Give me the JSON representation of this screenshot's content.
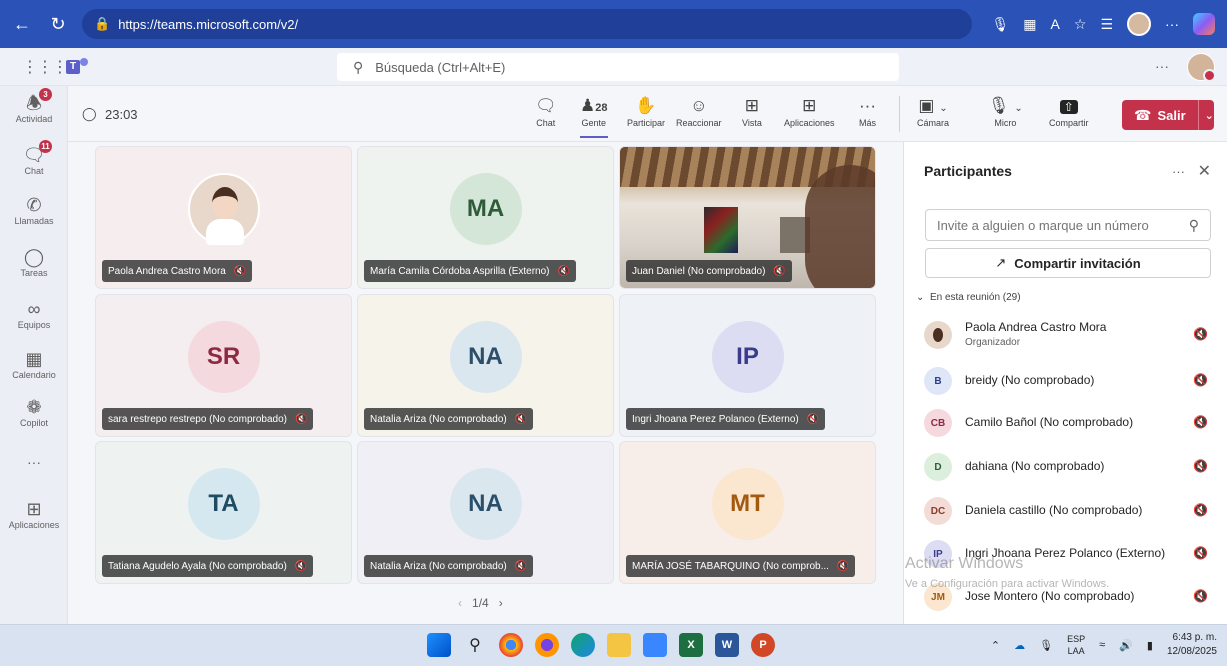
{
  "browser": {
    "url": "https://teams.microsoft.com/v2/"
  },
  "topbar": {
    "search_placeholder": "Búsqueda (Ctrl+Alt+E)",
    "more": "···"
  },
  "rail": [
    {
      "label": "Actividad",
      "icon": "bell-icon",
      "badge": "3"
    },
    {
      "label": "Chat",
      "icon": "chat-icon",
      "badge": "11"
    },
    {
      "label": "Llamadas",
      "icon": "phone-icon",
      "badge": ""
    },
    {
      "label": "Tareas",
      "icon": "tasks-icon",
      "badge": ""
    },
    {
      "label": "Equipos",
      "icon": "teams-icon",
      "badge": ""
    },
    {
      "label": "Calendario",
      "icon": "calendar-icon",
      "badge": ""
    },
    {
      "label": "Copilot",
      "icon": "copilot-icon",
      "badge": ""
    },
    {
      "label": "···",
      "icon": "more-icon",
      "badge": ""
    },
    {
      "label": "Aplicaciones",
      "icon": "apps-add-icon",
      "badge": ""
    }
  ],
  "meeting": {
    "timer": "23:03",
    "tools": [
      {
        "label": "Chat",
        "icon": "chat-icon"
      },
      {
        "label": "Gente",
        "icon": "people-icon",
        "count": "28"
      },
      {
        "label": "Participar",
        "icon": "raise-hand-icon"
      },
      {
        "label": "Reaccionar",
        "icon": "emoji-icon"
      },
      {
        "label": "Vista",
        "icon": "grid-icon"
      },
      {
        "label": "Aplicaciones",
        "icon": "apps-add-icon"
      },
      {
        "label": "Más",
        "icon": "more-icon"
      }
    ],
    "controls": [
      {
        "label": "Cámara",
        "icon": "camera-off-icon"
      },
      {
        "label": "Micro",
        "icon": "mic-off-icon"
      },
      {
        "label": "Compartir",
        "icon": "share-icon"
      }
    ],
    "leave_label": "Salir"
  },
  "tiles": [
    {
      "name": "Paola Andrea Castro Mora",
      "initials": "",
      "bg": "#f6eeee",
      "avatar_bg": "#e8d8cc",
      "avatar_fg": "#000000",
      "kind": "photo"
    },
    {
      "name": "María Camila Córdoba Asprilla (Externo)",
      "initials": "MA",
      "bg": "#eef3ef",
      "avatar_bg": "#d4e6d8",
      "avatar_fg": "#2f5b3a",
      "kind": "initials"
    },
    {
      "name": "Juan Daniel (No comprobado)",
      "initials": "",
      "bg": "#c9b9a5",
      "avatar_bg": "",
      "avatar_fg": "",
      "kind": "camera"
    },
    {
      "name": "sara restrepo restrepo (No comprobado)",
      "initials": "SR",
      "bg": "#f5eef0",
      "avatar_bg": "#f4d9df",
      "avatar_fg": "#8b2a40",
      "kind": "initials"
    },
    {
      "name": "Natalia Ariza (No comprobado)",
      "initials": "NA",
      "bg": "#f6f3ea",
      "avatar_bg": "#dbe7ef",
      "avatar_fg": "#2b4f6b",
      "kind": "initials"
    },
    {
      "name": "Ingri Jhoana Perez Polanco (Externo)",
      "initials": "IP",
      "bg": "#eef1f6",
      "avatar_bg": "#dcdcf2",
      "avatar_fg": "#3b3b8b",
      "kind": "initials"
    },
    {
      "name": "Tatiana Agudelo Ayala (No comprobado)",
      "initials": "TA",
      "bg": "#eef3f2",
      "avatar_bg": "#d6e8ef",
      "avatar_fg": "#1f4b63",
      "kind": "initials"
    },
    {
      "name": "Natalia Ariza (No comprobado)",
      "initials": "NA",
      "bg": "#f1eff6",
      "avatar_bg": "#dbe7ef",
      "avatar_fg": "#2b4f6b",
      "kind": "initials"
    },
    {
      "name": "MARÍA JOSÉ TABARQUINO (No comprob...",
      "initials": "MT",
      "bg": "#f7eeea",
      "avatar_bg": "#fbe6cf",
      "avatar_fg": "#a35a10",
      "kind": "initials"
    }
  ],
  "pager": {
    "label": "1/4"
  },
  "panel": {
    "title": "Participantes",
    "invite_placeholder": "Invite a alguien o marque un número",
    "share_label": "Compartir invitación",
    "section_label": "En esta reunión (29)",
    "participants": [
      {
        "initials": "",
        "name": "Paola Andrea Castro Mora",
        "role": "Organizador",
        "avatar_bg": "#e8d8cc",
        "avatar_fg": "#4a2e22"
      },
      {
        "initials": "B",
        "name": "breidy (No comprobado)",
        "role": "",
        "avatar_bg": "#dfe6f7",
        "avatar_fg": "#2b3e8b"
      },
      {
        "initials": "CB",
        "name": "Camilo Bañol (No comprobado)",
        "role": "",
        "avatar_bg": "#f6d9df",
        "avatar_fg": "#8b2a40"
      },
      {
        "initials": "D",
        "name": "dahiana (No comprobado)",
        "role": "",
        "avatar_bg": "#dcefdc",
        "avatar_fg": "#2f5b3a"
      },
      {
        "initials": "DC",
        "name": "Daniela castillo (No comprobado)",
        "role": "",
        "avatar_bg": "#f4dcd6",
        "avatar_fg": "#8b3a2a"
      },
      {
        "initials": "IP",
        "name": "Ingri Jhoana Perez Polanco (Externo)",
        "role": "",
        "avatar_bg": "#dcdcf2",
        "avatar_fg": "#3b3b8b"
      },
      {
        "initials": "JM",
        "name": "Jose Montero (No comprobado)",
        "role": "",
        "avatar_bg": "#fbe6cf",
        "avatar_fg": "#a35a10"
      }
    ]
  },
  "watermark": {
    "line1": "Activar Windows",
    "line2": "Ve a Configuración para activar Windows."
  },
  "taskbar": {
    "lang_top": "ESP",
    "lang_bottom": "LAA",
    "time": "6:43 p. m.",
    "date": "12/08/2025"
  }
}
